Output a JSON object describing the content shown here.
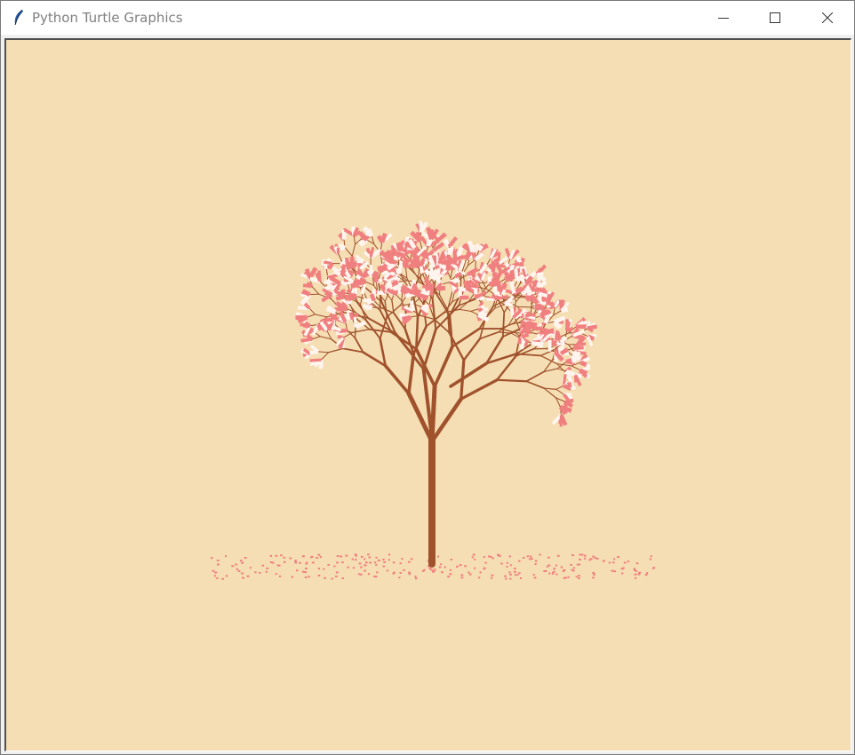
{
  "window": {
    "title": "Python Turtle Graphics",
    "app_icon": "feather-icon",
    "controls": [
      "minimize-icon",
      "maximize-icon",
      "close-icon"
    ]
  },
  "canvas": {
    "background": "#f5deb3",
    "trunk_color": "#a0522d",
    "blossom_colors": [
      "#f08080",
      "#fff5ee"
    ],
    "fallen_petal_color": "#f08080"
  }
}
